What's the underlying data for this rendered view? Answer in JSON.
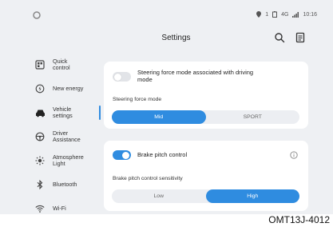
{
  "status_bar": {
    "left_icon": "ring-icon",
    "indicators": [
      "location-icon",
      "1",
      "battery-icon",
      "signal-icon"
    ],
    "signal_text": "4G",
    "time": "10:16"
  },
  "header": {
    "title": "Settings",
    "search_icon": "search-icon",
    "doc_icon": "document-icon"
  },
  "sidebar": {
    "items": [
      {
        "label": "Quick control",
        "line1": "Quick",
        "line2": "control",
        "icon": "quick-control-icon",
        "active": false
      },
      {
        "label": "New energy",
        "line1": "New energy",
        "line2": "",
        "icon": "new-energy-icon",
        "active": false
      },
      {
        "label": "Vehicle settings",
        "line1": "Vehicle",
        "line2": "settings",
        "icon": "car-icon",
        "active": true
      },
      {
        "label": "Driver Assistance",
        "line1": "Driver",
        "line2": "Assistance",
        "icon": "steering-wheel-icon",
        "active": false
      },
      {
        "label": "Atmosphere Light",
        "line1": "Atmosphere",
        "line2": "Light",
        "icon": "light-icon",
        "active": false
      },
      {
        "label": "Bluetooth",
        "line1": "Bluetooth",
        "line2": "",
        "icon": "bluetooth-icon",
        "active": false
      },
      {
        "label": "Wi-Fi",
        "line1": "Wi-Fi",
        "line2": "",
        "icon": "wifi-icon",
        "active": false
      }
    ]
  },
  "card1": {
    "toggle_label_1": "Steering force mode associated with driving",
    "toggle_label_2": "mode",
    "toggle_on": false,
    "section_label": "Steering force mode",
    "options": [
      "Mid",
      "SPORT"
    ],
    "selected": "Mid"
  },
  "card2": {
    "toggle_label": "Brake pitch control",
    "toggle_on": true,
    "section_label": "Brake pitch control sensitivity",
    "options": [
      "Low",
      "High"
    ],
    "selected": "High",
    "info_icon": "info-icon"
  },
  "watermark": "OMT13J-4012",
  "colors": {
    "accent": "#2f8ce0",
    "background": "#eef0f3",
    "card": "#ffffff"
  }
}
